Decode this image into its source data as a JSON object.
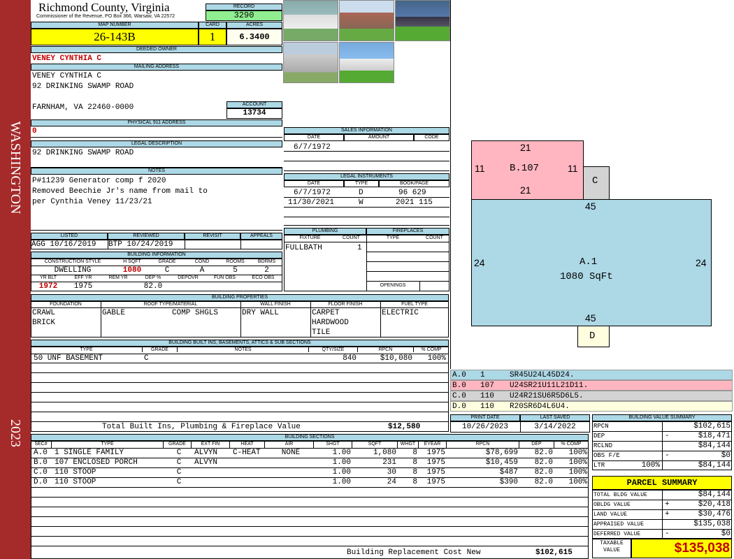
{
  "sidebar": {
    "district": "WASHINGTON",
    "year": "2023",
    "color": "#a52a2a"
  },
  "header": {
    "county": "Richmond County, Virginia",
    "commissioner": "Commissioner of the Revenue, PO Box 366, Warsaw, VA 22572",
    "record_label": "RECORD",
    "record": "3290",
    "map_label": "MAP NUMBER",
    "map": "26-143B",
    "card_label": "CARD",
    "card": "1",
    "acres_label": "ACRES",
    "acres": "6.3400"
  },
  "owner": {
    "deeded_label": "DEEDED OWNER",
    "deeded": "VENEY CYNTHIA C",
    "mailing_label": "MAILING ADDRESS",
    "mail1": "VENEY CYNTHIA C",
    "mail2": "92 DRINKING SWAMP ROAD",
    "mail3": "FARNHAM, VA 22460-0000",
    "account_label": "ACCOUNT",
    "account": "13734",
    "phys_label": "PHYSICAL 911 ADDRESS",
    "phys": "0"
  },
  "legal": {
    "label": "LEGAL DESCRIPTION",
    "text": "92 DRINKING SWAMP ROAD"
  },
  "notes": {
    "label": "NOTES",
    "lines": [
      "P#11239 Generator comp f 2020",
      "Removed Beechie Jr's name from mail to",
      "per Cynthia Veney 11/23/21"
    ]
  },
  "sales": {
    "label": "SALES INFORMATION",
    "h_date": "DATE",
    "h_amount": "AMOUNT",
    "h_code": "CODE",
    "date": "6/7/1972"
  },
  "instruments": {
    "label": "LEGAL INSTRUMENTS",
    "h_date": "DATE",
    "h_type": "TYPE",
    "h_book": "BOOK/PAGE",
    "rows": [
      {
        "date": "6/7/1972",
        "type": "D",
        "book": "96 629"
      },
      {
        "date": "11/30/2021",
        "type": "W",
        "book": "2021 115"
      }
    ]
  },
  "review": {
    "h_listed": "LISTED",
    "h_reviewed": "REVIEWED",
    "h_revisit": "REVISIT",
    "h_appeals": "APPEALS",
    "listed": "AGG 10/16/2019",
    "reviewed": "BTP 10/24/2019"
  },
  "building_info": {
    "label": "BUILDING INFORMATION",
    "h_style": "CONSTRUCTION STYLE",
    "h_hsqft": "H SQFT",
    "h_grade": "GRADE",
    "h_cond": "COND",
    "h_rooms": "ROOMS",
    "h_bdrms": "BDRMS",
    "style": "DWELLING",
    "hsqft": "1080",
    "grade": "C",
    "cond": "A",
    "rooms": "5",
    "bdrms": "2",
    "h_yrblt": "YR BLT",
    "h_effyr": "EFF YR",
    "h_remyr": "REM YR",
    "h_dep": "DEP %",
    "h_depovr": "DEPOVR",
    "h_funobs": "FUN OBS",
    "h_ecoobs": "ECO OBS",
    "yrblt": "1972",
    "effyr": "1975",
    "dep": "82.0"
  },
  "plumbing": {
    "label": "PLUMBING",
    "h_fixture": "FIXTURE",
    "h_count": "COUNT",
    "fixture": "FULLBATH",
    "count": "1"
  },
  "fireplaces": {
    "label": "FIREPLACES",
    "h_type": "TYPE",
    "h_count": "COUNT",
    "openings": "OPENINGS"
  },
  "props": {
    "label": "BUILDING PROPERTIES",
    "h_found": "FOUNDATION",
    "h_roof": "ROOF TYPE/MATERIAL",
    "h_wall": "WALL FINISH",
    "h_floor": "FLOOR FINISH",
    "h_fuel": "FUEL TYPE",
    "found1": "CRAWL",
    "found2": "BRICK",
    "roof1": "GABLE",
    "roof2": "COMP SHGLS",
    "wall": "DRY WALL",
    "floor1": "CARPET",
    "floor2": "HARDWOOD",
    "floor3": "TILE",
    "fuel": "ELECTRIC"
  },
  "builtins": {
    "label": "BUILDING BUILT INS, BASEMENTS, ATTICS & SUB SECTIONS",
    "h_type": "TYPE",
    "h_grade": "GRADE",
    "h_notes": "NOTES",
    "h_qty": "QTY/SIZE",
    "h_rpcn": "RPCN",
    "h_comp": "% COMP",
    "type": "50 UNF BASEMENT",
    "grade": "C",
    "qty": "840",
    "rpcn": "$10,080",
    "comp": "100%",
    "total_label": "Total Built Ins, Plumbing & Fireplace Value",
    "total": "$12,580"
  },
  "dates": {
    "print_label": "PRINT DATE",
    "saved_label": "LAST SAVED",
    "print": "10/26/2023",
    "saved": "3/14/2022"
  },
  "sections": {
    "label": "BUILDING SECTIONS",
    "headers": [
      "SEC#",
      "TYPE",
      "GRADE",
      "EXT FIN",
      "HEAT",
      "AIR",
      "SHGT",
      "SQFT",
      "WHGT",
      "EYEAR",
      "RPCN",
      "DEP",
      "% COMP"
    ],
    "rows": [
      {
        "sec": "A.0",
        "type": "1 SINGLE FAMILY",
        "grade": "C",
        "ext": "ALVYN",
        "heat": "C-HEAT",
        "air": "NONE",
        "shgt": "1.00",
        "sqft": "1,080",
        "whgt": "8",
        "eyear": "1975",
        "rpcn": "$78,699",
        "dep": "82.0",
        "comp": "100%"
      },
      {
        "sec": "B.0",
        "type": "107 ENCLOSED PORCH",
        "grade": "C",
        "ext": "ALVYN",
        "heat": "",
        "air": "",
        "shgt": "1.00",
        "sqft": "231",
        "whgt": "8",
        "eyear": "1975",
        "rpcn": "$10,459",
        "dep": "82.0",
        "comp": "100%"
      },
      {
        "sec": "C.0",
        "type": "110 STOOP",
        "grade": "C",
        "ext": "",
        "heat": "",
        "air": "",
        "shgt": "1.00",
        "sqft": "30",
        "whgt": "8",
        "eyear": "1975",
        "rpcn": "$487",
        "dep": "82.0",
        "comp": "100%"
      },
      {
        "sec": "D.0",
        "type": "110 STOOP",
        "grade": "C",
        "ext": "",
        "heat": "",
        "air": "",
        "shgt": "1.00",
        "sqft": "24",
        "whgt": "8",
        "eyear": "1975",
        "rpcn": "$390",
        "dep": "82.0",
        "comp": "100%"
      }
    ],
    "replacement_label": "Building Replacement Cost New",
    "replacement": "$102,615"
  },
  "sketch": {
    "a_label": "A.1",
    "a_area": "1080 SqFt",
    "a_top": "45",
    "a_bottom": "45",
    "a_left": "24",
    "a_right": "24",
    "b_label": "B.107",
    "b_top": "21",
    "b_bottom": "21",
    "b_left": "11",
    "b_right": "11",
    "c_label": "C",
    "d_label": "D",
    "colors": {
      "a": "#add8e6",
      "b": "#ffb6c1",
      "c": "#d3d3d3",
      "d": "#ffffe0"
    }
  },
  "sketch_legend": [
    {
      "sec": "A.0",
      "code": "1",
      "vec": "SR45U24L45D24."
    },
    {
      "sec": "B.0",
      "code": "107",
      "vec": "U24SR21U11L21D11."
    },
    {
      "sec": "C.0",
      "code": "110",
      "vec": "U24R21SU6R5D6L5."
    },
    {
      "sec": "D.0",
      "code": "110",
      "vec": "R20SR6D4L6U4."
    }
  ],
  "bvs": {
    "label": "BUILDING VALUE SUMMARY",
    "rpcn_l": "RPCN",
    "rpcn": "$102,615",
    "dep_l": "DEP",
    "dep_s": "-",
    "dep": "$18,471",
    "rclnd_l": "RCLND",
    "rclnd": "$84,144",
    "obs_l": "OBS F/E",
    "obs_s": "-",
    "obs": "$0",
    "ltr_l": "LTR",
    "ltr_p": "100%",
    "ltr": "$84,144"
  },
  "parcel": {
    "label": "PARCEL SUMMARY",
    "tbv_l": "TOTAL BLDG VALUE",
    "tbv": "$84,144",
    "obldg_l": "OBLDG VALUE",
    "obldg_s": "+",
    "obldg": "$20,418",
    "land_l": "LAND VALUE",
    "land_s": "+",
    "land": "$30,476",
    "appr_l": "APPRAISED VALUE",
    "appr": "$135,038",
    "def_l": "DEFERRED VALUE",
    "def_s": "-",
    "def": "$0",
    "tax_l1": "TAXABLE",
    "tax_l2": "VALUE",
    "tax": "$135,038"
  }
}
